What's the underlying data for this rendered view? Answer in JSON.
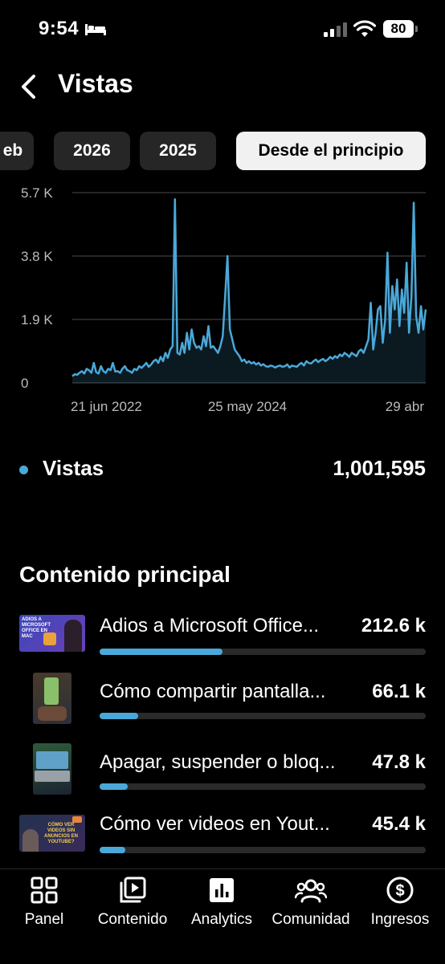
{
  "status_bar": {
    "time": "9:54",
    "battery": "80"
  },
  "header": {
    "title": "Vistas"
  },
  "chips": [
    "eb",
    "2026",
    "2025",
    "Desde el principio"
  ],
  "chart_data": {
    "type": "line",
    "yticks": [
      "5.7 K",
      "3.8 K",
      "1.9 K",
      "0"
    ],
    "ylim": [
      0,
      5700
    ],
    "xticks": [
      "21 jun 2022",
      "25 may 2024",
      "29 abr"
    ],
    "color": "#4aa8d8",
    "grid": true,
    "series": [
      {
        "values": [
          200,
          260,
          240,
          300,
          350,
          280,
          420,
          380,
          300,
          600,
          320,
          280,
          500,
          350,
          300,
          420,
          380,
          600,
          340,
          350,
          300,
          420,
          500,
          380,
          350,
          300,
          420,
          380,
          500,
          450,
          520,
          600,
          480,
          550,
          650,
          700,
          600,
          780,
          650,
          900,
          750,
          1000,
          1100,
          5500,
          900,
          850,
          1200,
          900,
          1500,
          1000,
          1600,
          1200,
          1050,
          1100,
          1000,
          1400,
          1100,
          1700,
          1050,
          1100,
          1000,
          900,
          1100,
          1400,
          2600,
          3800,
          1600,
          1300,
          1000,
          900,
          800,
          650,
          700,
          600,
          650,
          580,
          620,
          550,
          600,
          520,
          560,
          500,
          480,
          520,
          500,
          460,
          500,
          520,
          480,
          500,
          550,
          460,
          520,
          500,
          480,
          550,
          600,
          520,
          650,
          600,
          580,
          650,
          700,
          620,
          680,
          720,
          650,
          700,
          780,
          720,
          800,
          750,
          850,
          800,
          900,
          850,
          780,
          900,
          850,
          800,
          950,
          1000,
          900,
          1100,
          1300,
          2400,
          1000,
          1500,
          2200,
          2300,
          1200,
          1900,
          3900,
          1500,
          2900,
          2200,
          3100,
          1700,
          2800,
          2100,
          3600,
          1500,
          2600,
          5400,
          2000,
          1500,
          2300,
          1600,
          2200
        ]
      }
    ]
  },
  "summary": {
    "label": "Vistas",
    "value": "1,001,595"
  },
  "top_content": {
    "title": "Contenido principal",
    "items": [
      {
        "title": "Adios a Microsoft Office...",
        "value": "212.6 k",
        "fraction": 0.377,
        "thumb_text": "ADIOS A MICROSOFT OFFICE EN MAC"
      },
      {
        "title": "Cómo compartir pantalla...",
        "value": "66.1 k",
        "fraction": 0.118
      },
      {
        "title": "Apagar, suspender o bloq...",
        "value": "47.8 k",
        "fraction": 0.085
      },
      {
        "title": "Cómo ver videos en Yout...",
        "value": "45.4 k",
        "fraction": 0.08,
        "thumb_text": "CÓMO VER VIDEOS SIN ANUNCIOS EN YOUTUBE?"
      }
    ]
  },
  "bottom_nav": [
    {
      "label": "Panel",
      "icon": "grid-icon"
    },
    {
      "label": "Contenido",
      "icon": "video-library-icon"
    },
    {
      "label": "Analytics",
      "icon": "bar-chart-icon"
    },
    {
      "label": "Comunidad",
      "icon": "people-icon"
    },
    {
      "label": "Ingresos",
      "icon": "dollar-icon"
    }
  ]
}
